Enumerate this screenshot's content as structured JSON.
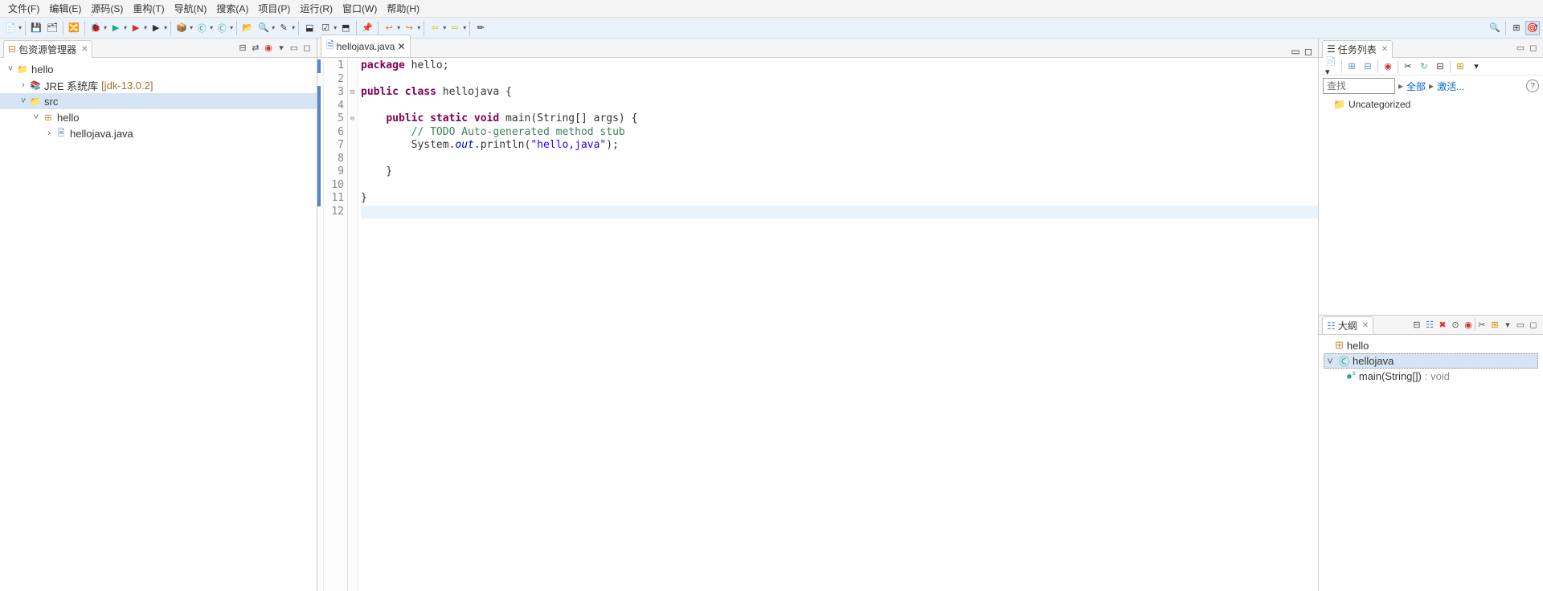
{
  "menu": [
    "文件(F)",
    "编辑(E)",
    "源码(S)",
    "重构(T)",
    "导航(N)",
    "搜索(A)",
    "项目(P)",
    "运行(R)",
    "窗口(W)",
    "帮助(H)"
  ],
  "package_explorer": {
    "title": "包资源管理器",
    "project": "hello",
    "jre_label": "JRE 系统库",
    "jre_version": "[jdk-13.0.2]",
    "src": "src",
    "pkg": "hello",
    "file": "hellojava.java"
  },
  "editor": {
    "tab": "hellojava.java",
    "lines": [
      {
        "n": 1,
        "html": "<span class='kw'>package</span> hello;"
      },
      {
        "n": 2,
        "html": ""
      },
      {
        "n": 3,
        "html": "<span class='kw'>public</span> <span class='kw'>class</span> hellojava {",
        "fold": "-"
      },
      {
        "n": 4,
        "html": ""
      },
      {
        "n": 5,
        "html": "    <span class='kw'>public</span> <span class='kw'>static</span> <span class='kw'>void</span> main(String[] args) {",
        "fold": "-",
        "mark": "⊖"
      },
      {
        "n": 6,
        "html": "        <span class='com'>// TODO Auto-generated method stub</span>"
      },
      {
        "n": 7,
        "html": "        System.<span class='fld'>out</span>.println(<span class='str'>\"hello,java\"</span>);"
      },
      {
        "n": 8,
        "html": ""
      },
      {
        "n": 9,
        "html": "    }"
      },
      {
        "n": 10,
        "html": ""
      },
      {
        "n": 11,
        "html": "}"
      },
      {
        "n": 12,
        "html": "",
        "current": true
      }
    ]
  },
  "tasks": {
    "title": "任务列表",
    "search_placeholder": "查找",
    "all": "全部",
    "activate": "激活...",
    "uncategorized": "Uncategorized"
  },
  "outline": {
    "title": "大纲",
    "pkg": "hello",
    "cls": "hellojava",
    "method": "main(String[])",
    "ret": ": void"
  }
}
